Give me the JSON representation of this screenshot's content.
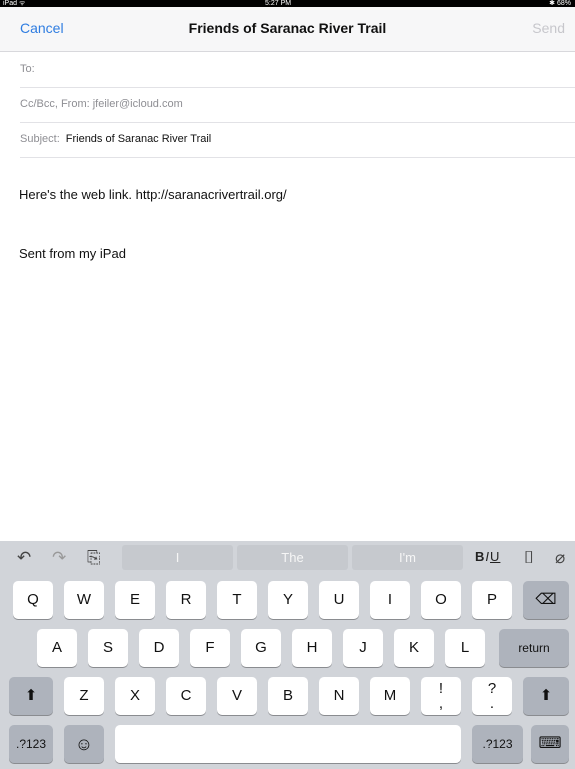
{
  "status_bar": {
    "left": "iPad ᯤ",
    "time": "5:27 PM",
    "battery": "✱ 68%"
  },
  "navbar": {
    "cancel": "Cancel",
    "title": "Friends of Saranac River Trail",
    "send": "Send"
  },
  "fields": {
    "to_label": "To:",
    "cc_label": "Cc/Bcc, From:",
    "from_value": "jfeiler@icloud.com",
    "subject_label": "Subject:",
    "subject_value": "Friends of Saranac River Trail"
  },
  "body": {
    "line1": "Here's the web link. http://saranacrivertrail.org/",
    "signature": "Sent from my iPad"
  },
  "keyboard": {
    "toolbar": {
      "undo": "↶",
      "redo": "↷",
      "paste": "⎘",
      "suggestions": [
        "I",
        "The",
        "I'm"
      ],
      "format": "BIU",
      "camera": "⌷",
      "attach": "⌀"
    },
    "row1": [
      "Q",
      "W",
      "E",
      "R",
      "T",
      "Y",
      "U",
      "I",
      "O",
      "P"
    ],
    "backspace": "⌫",
    "row2": [
      "A",
      "S",
      "D",
      "F",
      "G",
      "H",
      "J",
      "K",
      "L"
    ],
    "return": "return",
    "row3": [
      "Z",
      "X",
      "C",
      "V",
      "B",
      "N",
      "M",
      "!\n,",
      "?\n."
    ],
    "shift": "⬆",
    "numbers": ".?123",
    "emoji": "☺",
    "hide_keyboard": "⌨"
  }
}
